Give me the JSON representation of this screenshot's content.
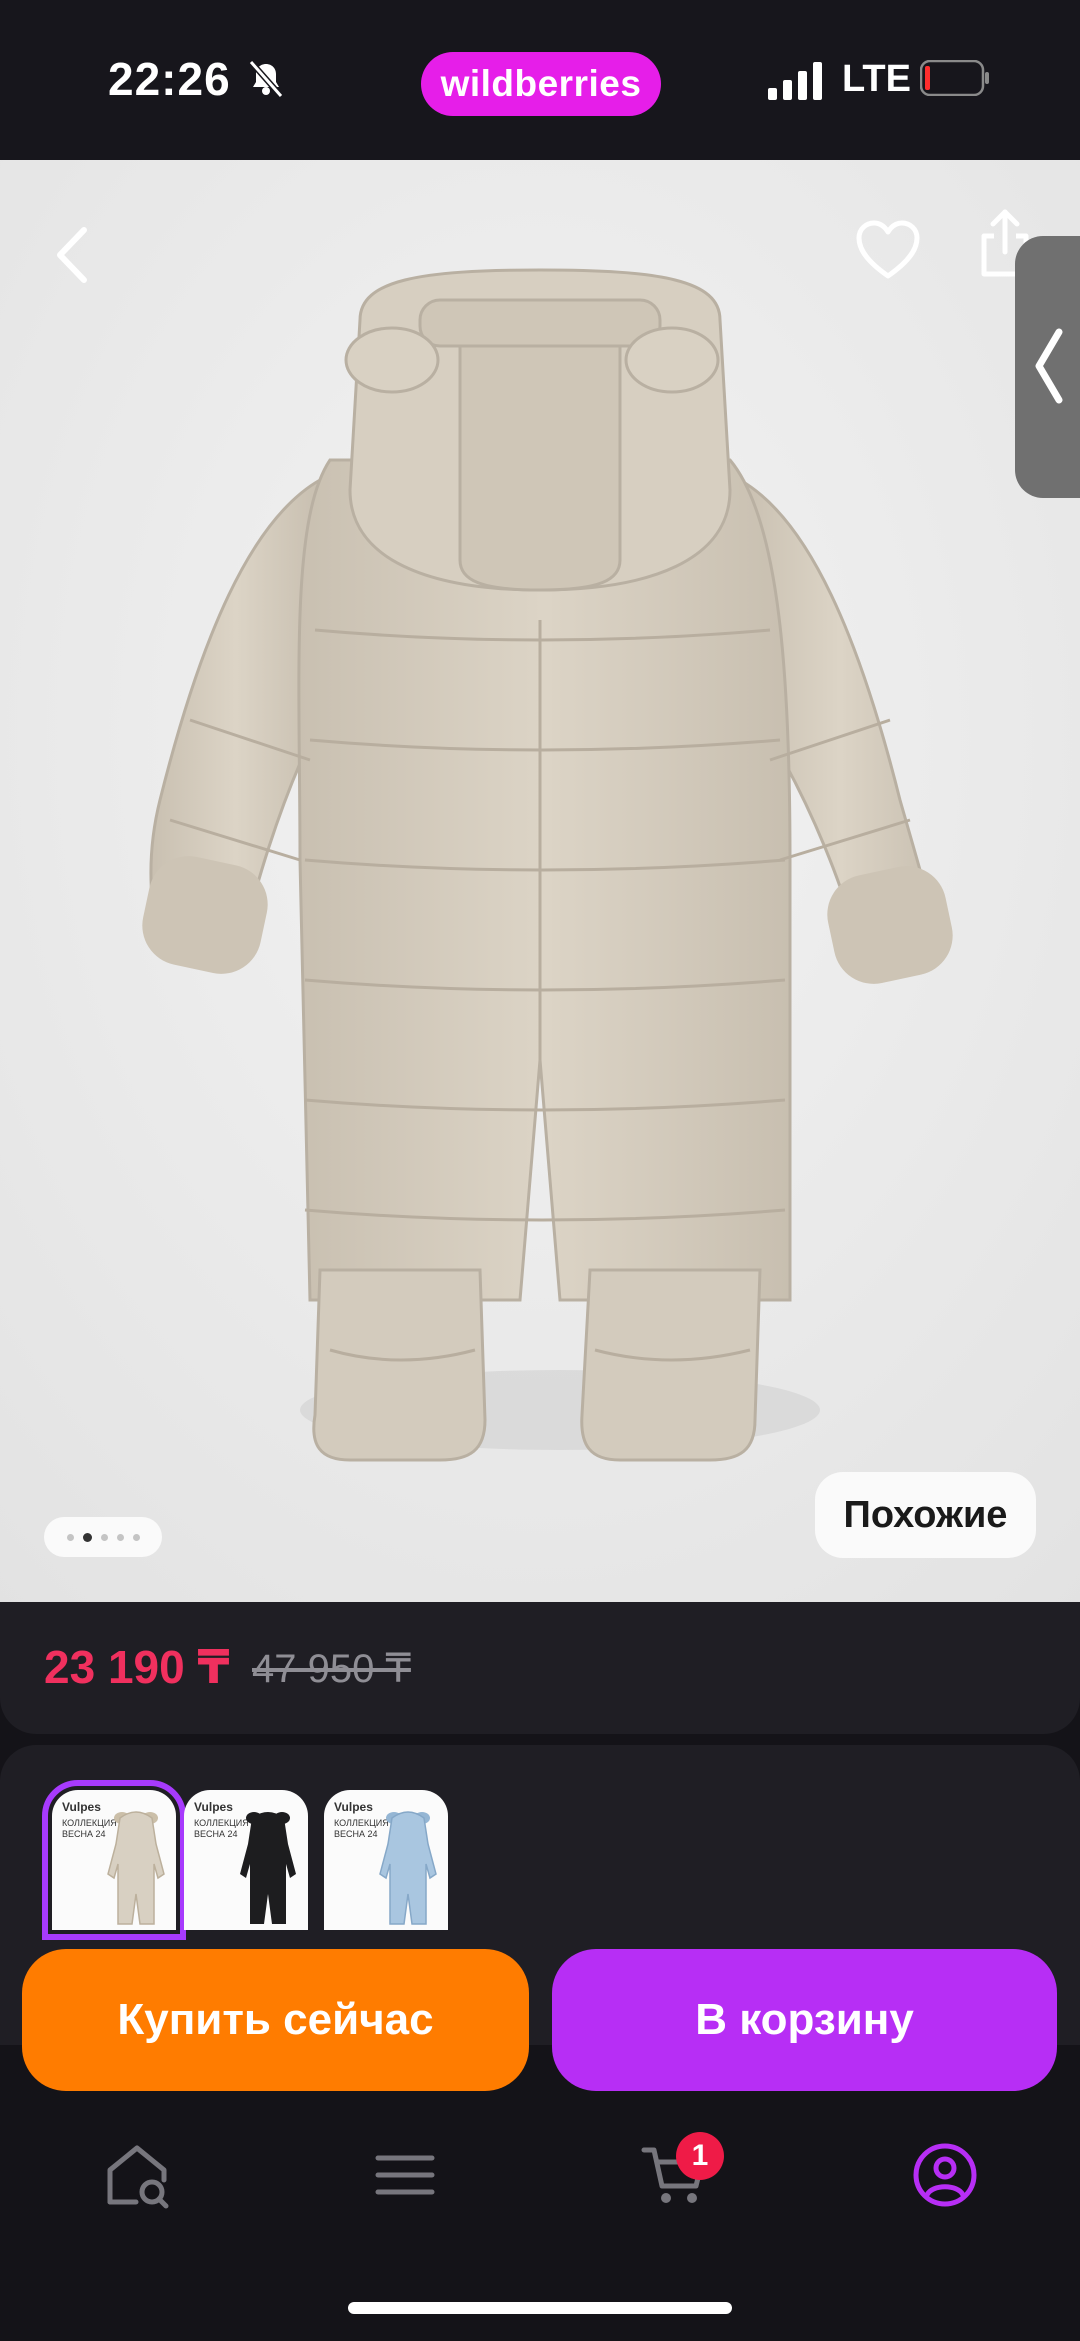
{
  "status_bar": {
    "time": "22:26",
    "brand": "wildberries",
    "network": "LTE",
    "brand_color": "#e61ee9"
  },
  "hero": {
    "similar_label": "Похожие",
    "image_count": 5,
    "current_image": 2,
    "icons": [
      "back-icon",
      "heart-icon",
      "share-icon",
      "chevron-left-icon"
    ]
  },
  "price": {
    "current": "23 190 ₸",
    "old": "47 950 ₸",
    "color": "#f0305e"
  },
  "variants": [
    {
      "brand": "Vulpes",
      "collection": "КОЛЛЕКЦИЯ ВЕСНА 24",
      "color": "#d8d0c2",
      "selected": true
    },
    {
      "brand": "Vulpes",
      "collection": "КОЛЛЕКЦИЯ ВЕСНА 24",
      "color": "#1d1d1f",
      "selected": false
    },
    {
      "brand": "Vulpes",
      "collection": "КОЛЛЕКЦИЯ ВЕСНА 24",
      "color": "#a9c6e0",
      "selected": false
    }
  ],
  "actions": {
    "buy_now": "Купить сейчас",
    "add_to_cart": "В корзину",
    "buy_color": "#ff7c00",
    "cart_color": "#b72ef5"
  },
  "bottom_nav": {
    "items": [
      "home-search-icon",
      "menu-icon",
      "cart-icon",
      "profile-icon"
    ],
    "cart_badge": "1",
    "active_color": "#b72ef5"
  }
}
